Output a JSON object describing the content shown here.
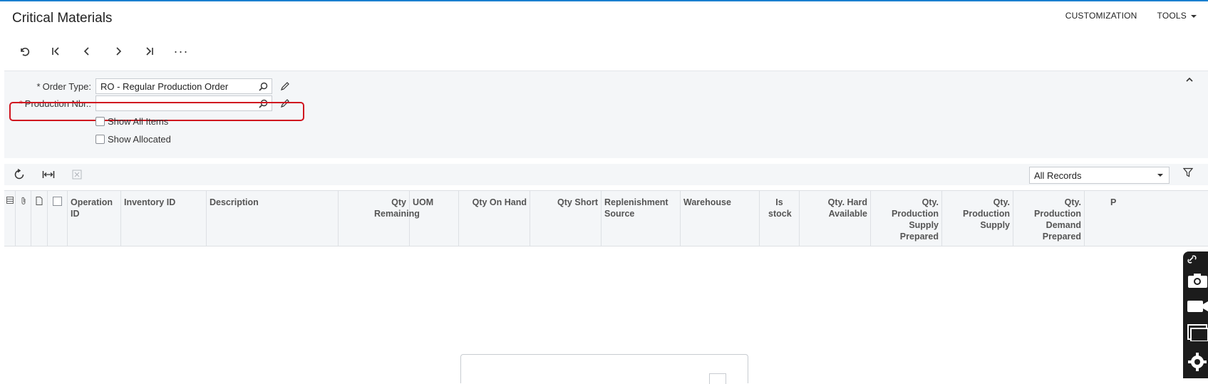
{
  "header": {
    "title": "Critical Materials",
    "menu": {
      "customization": "CUSTOMIZATION",
      "tools": "TOOLS"
    }
  },
  "toolbar": {
    "buttons": [
      "undo-icon",
      "first-record-icon",
      "previous-icon",
      "next-icon",
      "last-record-icon",
      "more-icon"
    ],
    "more_label": "···"
  },
  "form": {
    "order_type": {
      "label": "Order Type:",
      "value": "RO - Regular Production Order"
    },
    "production_nbr": {
      "label": "Production Nbr.:",
      "value": ""
    },
    "show_all_items": {
      "label": "Show All Items",
      "checked": false
    },
    "show_allocated": {
      "label": "Show Allocated",
      "checked": false
    }
  },
  "grid_toolbar": {
    "filter_select": {
      "value": "All Records"
    }
  },
  "grid": {
    "columns": [
      {
        "key": "operation_id",
        "label": "Operation ID"
      },
      {
        "key": "inventory_id",
        "label": "Inventory ID"
      },
      {
        "key": "description",
        "label": "Description"
      },
      {
        "key": "qty_remaining",
        "label": "Qty Remaining"
      },
      {
        "key": "uom",
        "label": "UOM"
      },
      {
        "key": "qty_on_hand",
        "label": "Qty On Hand"
      },
      {
        "key": "qty_short",
        "label": "Qty Short"
      },
      {
        "key": "replenishment_source",
        "label": "Replenishment Source"
      },
      {
        "key": "warehouse",
        "label": "Warehouse"
      },
      {
        "key": "is_stock",
        "label": "Is stock"
      },
      {
        "key": "qty_hard_available",
        "label": "Qty. Hard Available"
      },
      {
        "key": "qty_prod_supply_prepared",
        "label": "Qty. Production Supply Prepared"
      },
      {
        "key": "qty_prod_supply",
        "label": "Qty. Production Supply"
      },
      {
        "key": "qty_prod_demand_prepared",
        "label": "Qty. Production Demand Prepared"
      },
      {
        "key": "truncated",
        "label": "P"
      }
    ],
    "rows": []
  },
  "colors": {
    "accent": "#1a7fd0",
    "highlight": "#d0141f",
    "panel": "#f4f6f8"
  }
}
